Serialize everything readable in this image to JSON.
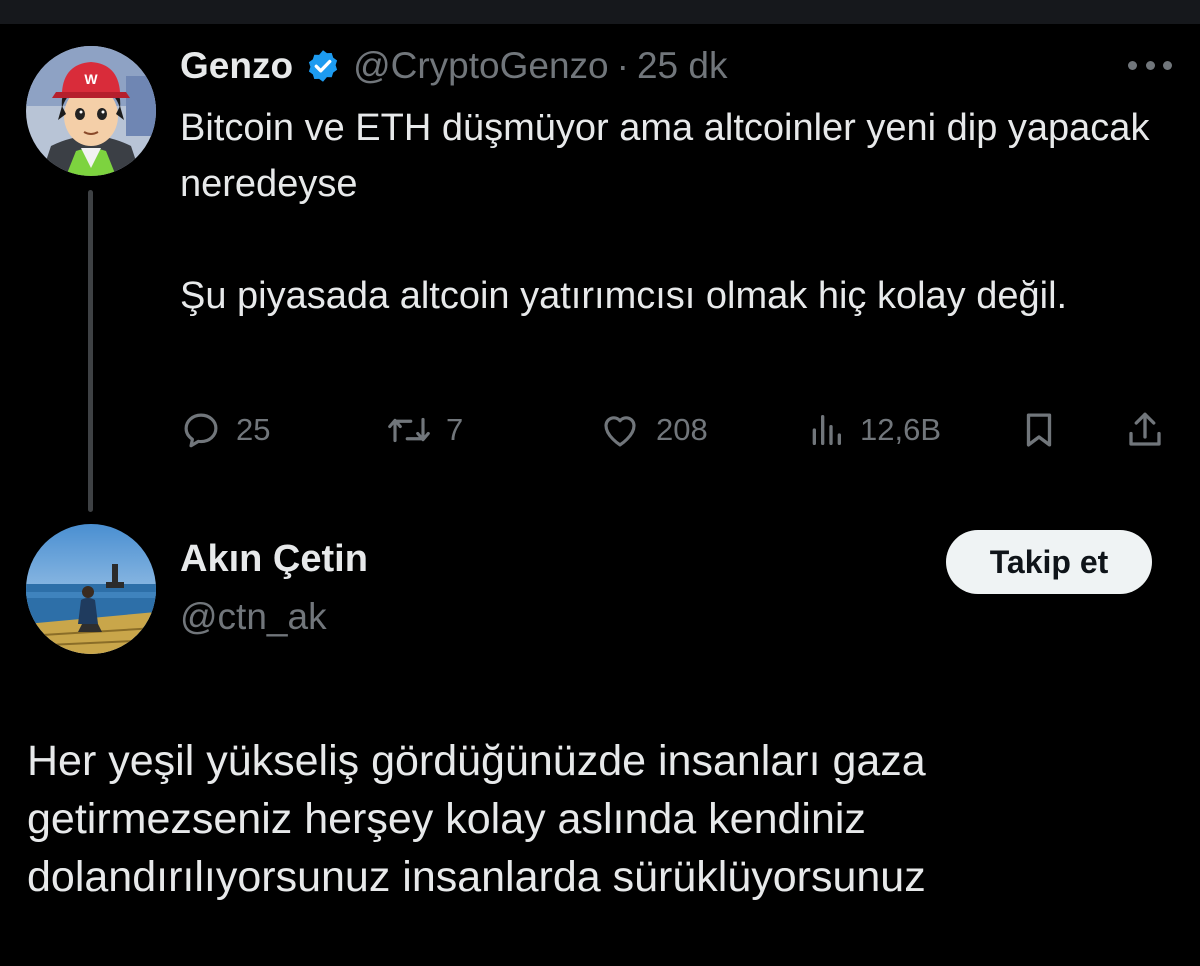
{
  "parent_tweet": {
    "author": {
      "name": "Genzo",
      "handle": "@CryptoGenzo",
      "verified": true,
      "avatar_icon": "anime-avatar-red-cap"
    },
    "separator": "·",
    "time": "25 dk",
    "menu_icon": "more-icon",
    "text": [
      "Bitcoin ve ETH düşmüyor ama altcoinler yeni dip yapacak neredeyse",
      "Şu piyasada altcoin yatırımcısı olmak hiç kolay değil."
    ],
    "actions": {
      "replies": "25",
      "retweets": "7",
      "likes": "208",
      "views": "12,6B"
    }
  },
  "reply_tweet": {
    "author": {
      "name": "Akın Çetin",
      "handle": "@ctn_ak",
      "avatar_icon": "sea-photo-avatar"
    },
    "follow_label": "Takip et",
    "text": "Her yeşil yükseliş gördüğünüzde insanları gaza getirmezseniz herşey kolay aslında kendiniz dolandırılıyorsunuz insanlarda sürüklüyorsunuz"
  },
  "colors": {
    "background": "#000000",
    "text_primary": "#e7e9ea",
    "text_secondary": "#71767b",
    "verified_blue": "#1d9bf0",
    "button_bg": "#eff3f4"
  }
}
